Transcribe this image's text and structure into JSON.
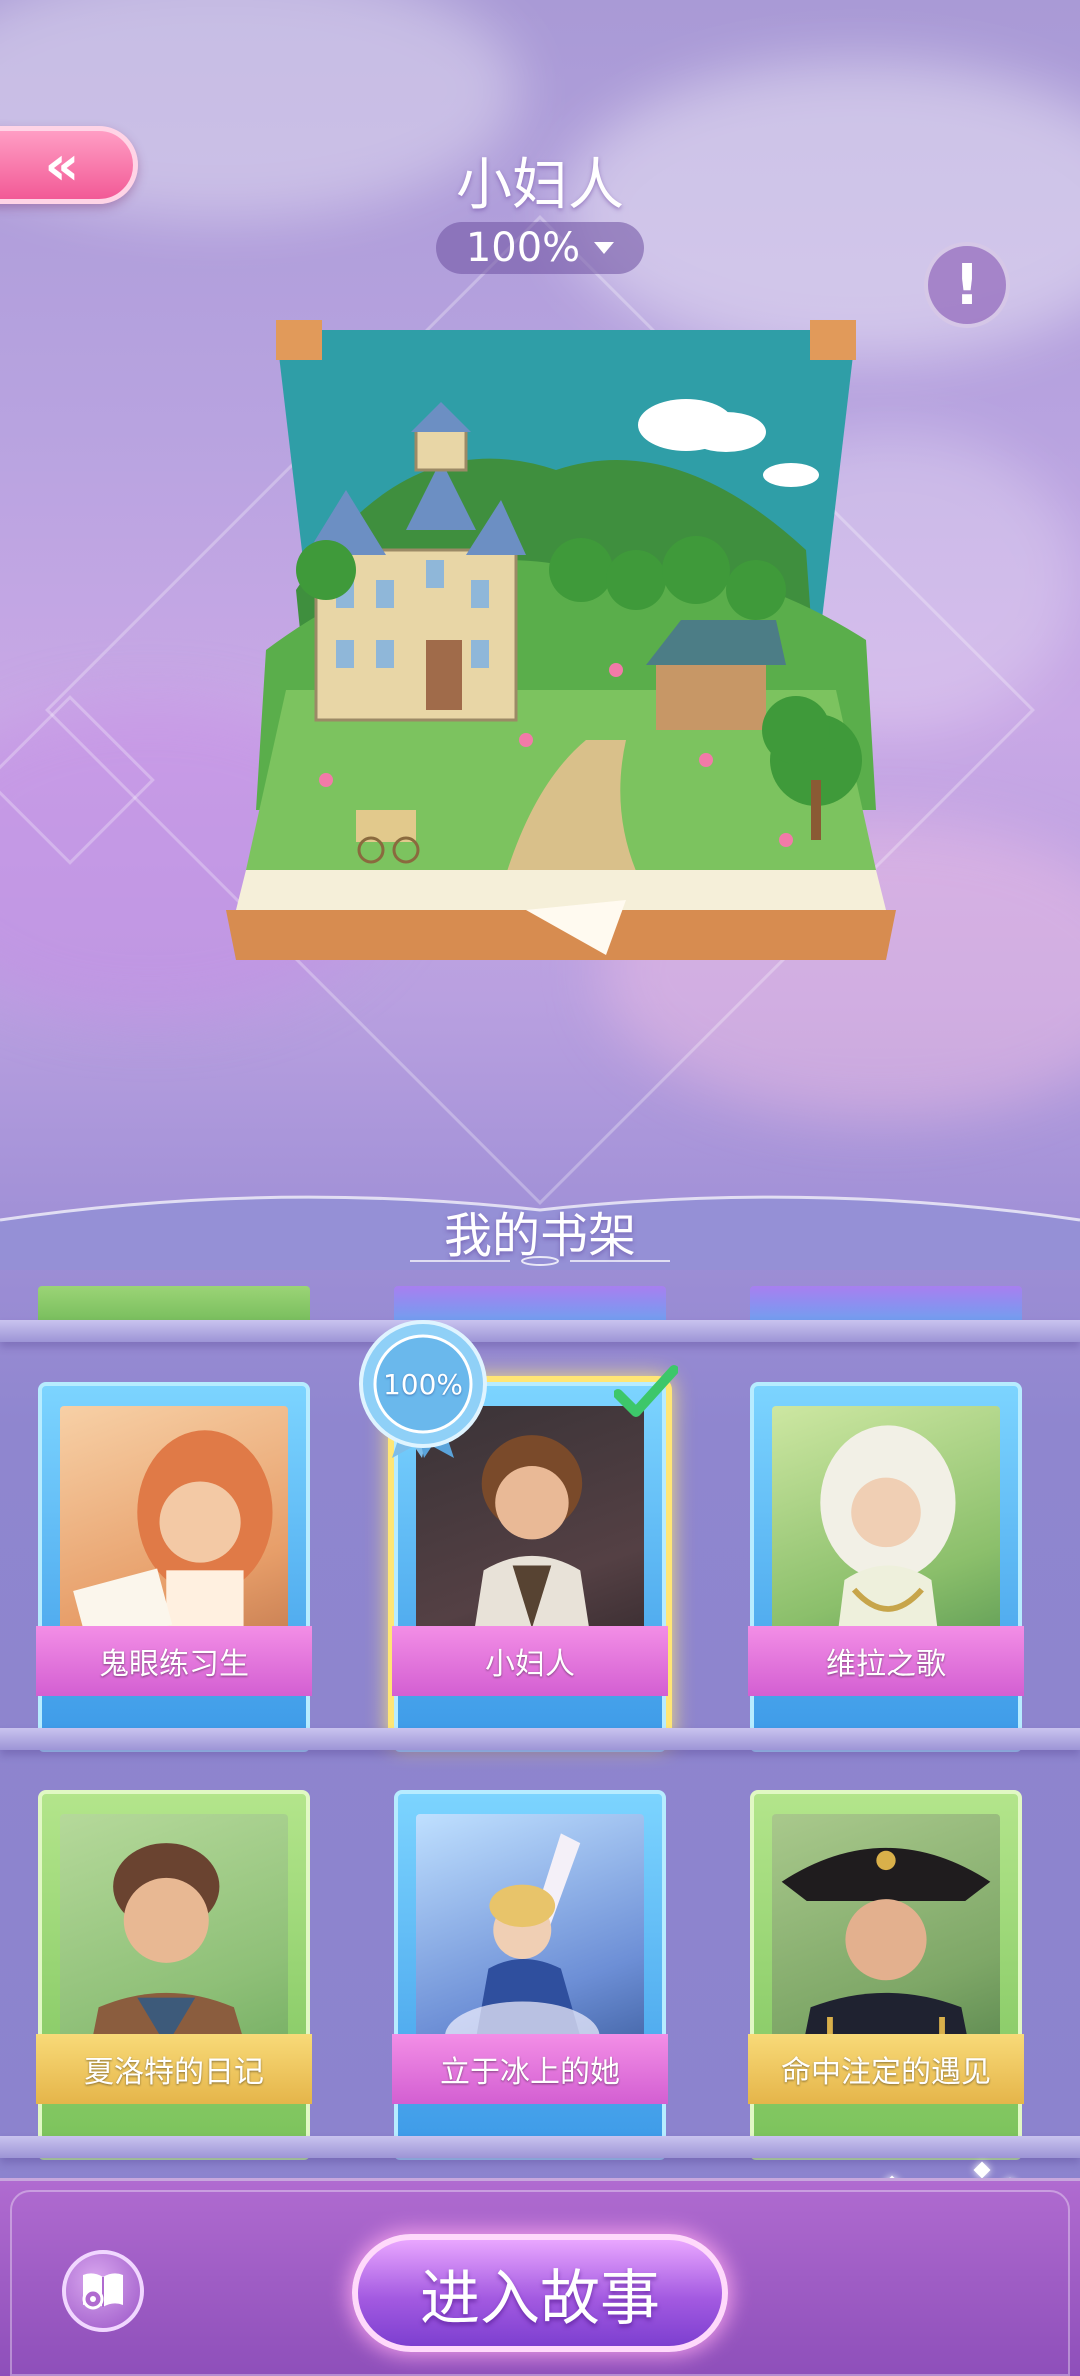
{
  "header": {
    "title": "小妇人",
    "progress_label": "100%",
    "progress_value": 1.0
  },
  "icons": {
    "back": "double-chevron-left-icon",
    "info": "exclamation-icon",
    "dropdown": "triangle-down-icon",
    "checkmark": "checkmark-icon",
    "library": "book-gear-icon"
  },
  "shelf": {
    "title": "我的书架",
    "books": [
      {
        "title": "鬼眼练习生",
        "theme": "blue",
        "ribbon": "pink"
      },
      {
        "title": "小妇人",
        "theme": "blue",
        "ribbon": "pink",
        "selected": true,
        "badge": "100%"
      },
      {
        "title": "维拉之歌",
        "theme": "blue",
        "ribbon": "pink"
      },
      {
        "title": "夏洛特的日记",
        "theme": "green",
        "ribbon": "gold"
      },
      {
        "title": "立于冰上的她",
        "theme": "blue",
        "ribbon": "pink"
      },
      {
        "title": "命中注定的遇见",
        "theme": "green",
        "ribbon": "gold"
      }
    ]
  },
  "actions": {
    "enter_story": "进入故事"
  },
  "colors": {
    "accent_pink": "#f25a96",
    "ribbon_pink": "#d35fd2",
    "ribbon_gold": "#e5b54a",
    "selected_glow": "#ffe675",
    "button_purple": "#a35ae1"
  }
}
